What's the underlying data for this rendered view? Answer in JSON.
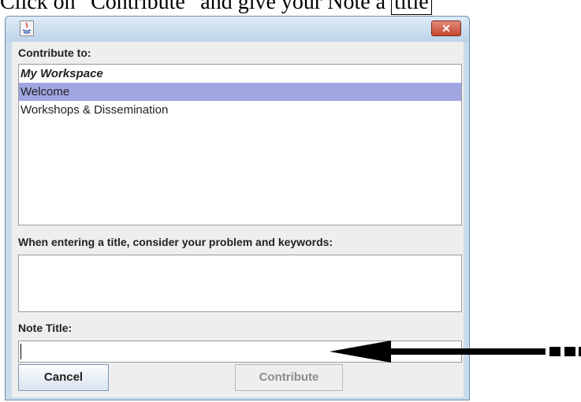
{
  "doc_fragment": {
    "before": "Click on “Contribute” and give your Note a ",
    "boxed": "title"
  },
  "dialog": {
    "close_glyph": "✕",
    "contribute_to_label": "Contribute to:",
    "list_items": [
      {
        "label": "My Workspace",
        "style": "header"
      },
      {
        "label": "Welcome",
        "style": "selected"
      },
      {
        "label": "Workshops & Dissemination",
        "style": "normal"
      }
    ],
    "title_hint_label": "When entering a title, consider your problem and keywords:",
    "note_title_label": "Note Title:",
    "note_title_value": "",
    "cancel_label": "Cancel",
    "contribute_label": "Contribute"
  },
  "icons": {
    "app_icon": "java-icon",
    "close_icon": "close-icon",
    "pointer_arrow": "arrow-icon"
  },
  "colors": {
    "selection": "#a0a6e2",
    "close_button": "#c4452f",
    "window_frame": "#c9dced"
  }
}
